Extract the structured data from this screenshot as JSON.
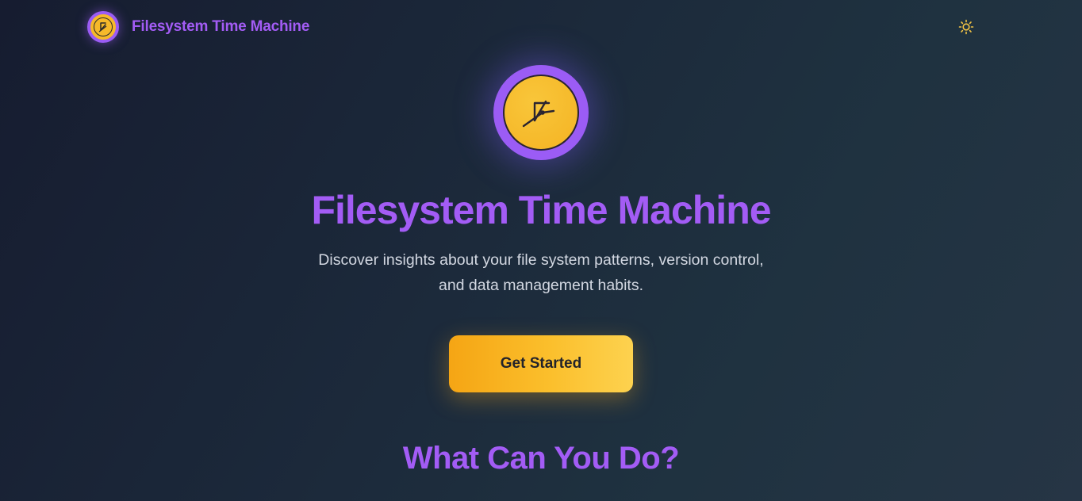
{
  "header": {
    "brand_name": "Filesystem Time Machine",
    "brand_icon": "clock-icon",
    "theme_toggle_icon": "sun-icon"
  },
  "hero": {
    "logo_icon": "clock-icon",
    "title": "Filesystem Time Machine",
    "subtitle": "Discover insights about your file system patterns, version control, and data management habits.",
    "cta_label": "Get Started"
  },
  "features": {
    "title": "What Can You Do?"
  },
  "colors": {
    "accent_purple": "#a35cf5",
    "accent_gold": "#fbbf2c",
    "background": "#1c2a3b"
  }
}
